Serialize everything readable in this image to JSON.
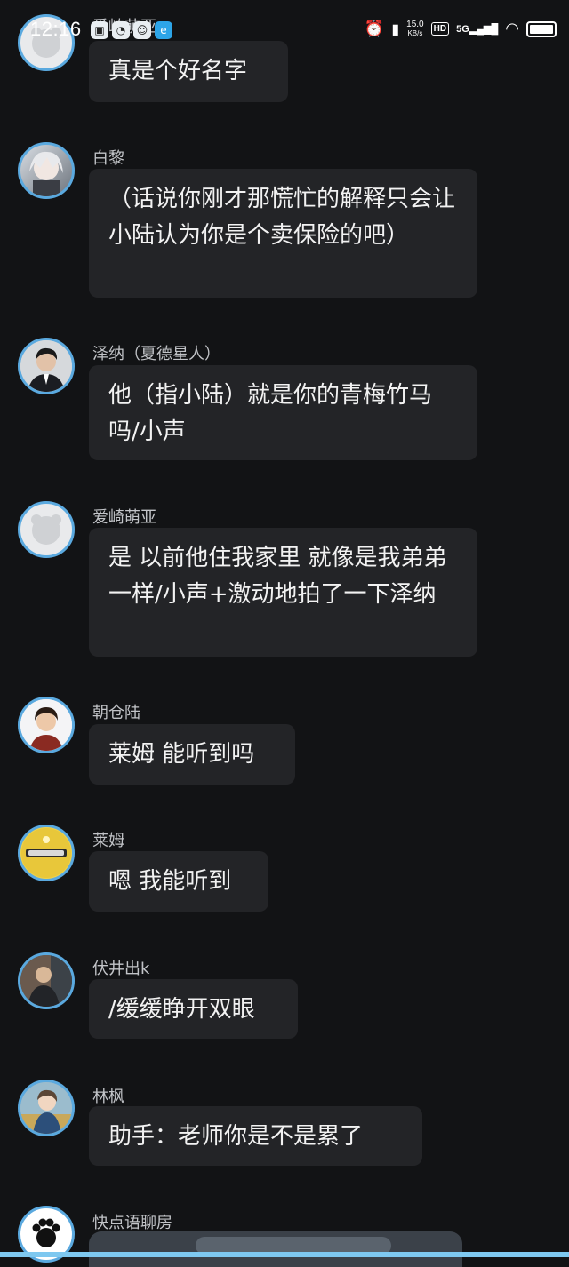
{
  "status_bar": {
    "time": "12:16",
    "net_speed_value": "15.0",
    "net_speed_unit": "KB/s",
    "hd": "HD",
    "network": "5G",
    "icons": [
      "alarm-icon",
      "vibrate-icon",
      "signal-icon",
      "wifi-icon",
      "battery-icon"
    ],
    "app_icons": [
      "bilibili-icon",
      "browser-icon",
      "game-icon",
      "app-icon"
    ]
  },
  "messages": [
    {
      "name": "爱崎萌亚",
      "text": "真是个好名字",
      "avatar": "default-avatar"
    },
    {
      "name": "白黎",
      "text": "（话说你刚才那慌忙的解释只会让小陆认为你是个卖保险的吧）",
      "avatar": "anime-avatar-white-hair"
    },
    {
      "name": "泽纳（夏德星人）",
      "text": "他（指小陆）就是你的青梅竹马吗/小声",
      "avatar": "suit-man-avatar"
    },
    {
      "name": "爱崎萌亚",
      "text": "是 以前他住我家里 就像是我弟弟一样/小声+激动地拍了一下泽纳",
      "avatar": "default-avatar"
    },
    {
      "name": "朝仓陆",
      "text": "莱姆 能听到吗",
      "avatar": "hero-avatar"
    },
    {
      "name": "莱姆",
      "text": "嗯 我能听到",
      "avatar": "yellow-robot-avatar"
    },
    {
      "name": "伏井出k",
      "text": "/缓缓睁开双眼",
      "avatar": "dark-suit-avatar"
    },
    {
      "name": "林枫",
      "text": "助手：老师你是不是累了",
      "avatar": "anime-avatar-blue"
    },
    {
      "name": "快点语聊房",
      "text": "",
      "avatar": "paw-avatar"
    }
  ],
  "colors": {
    "background": "#121315",
    "bubble": "#232427",
    "avatar_ring": "#5aa9df",
    "name_text": "#c2c4c8"
  }
}
